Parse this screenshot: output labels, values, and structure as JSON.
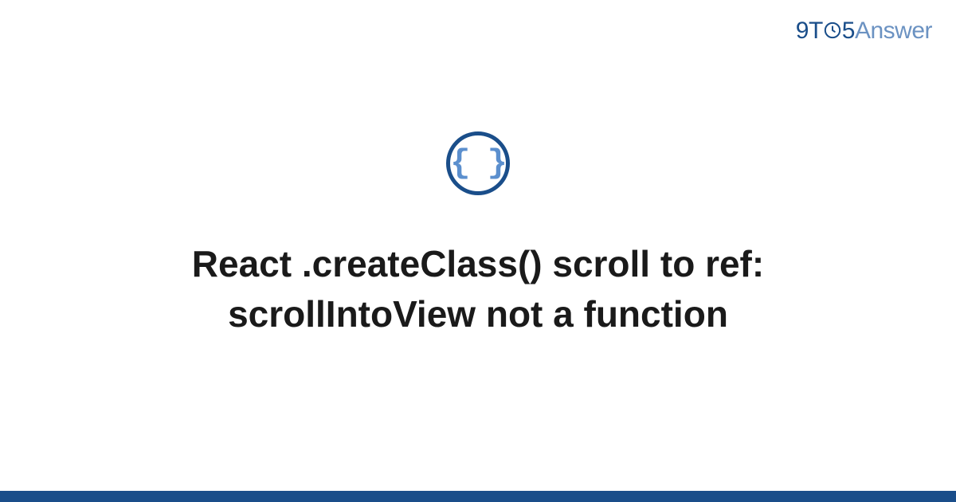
{
  "logo": {
    "nine": "9",
    "t": "T",
    "five": "5",
    "answer": "Answer"
  },
  "icon": {
    "braces": "{ }"
  },
  "title": "React .createClass() scroll to ref: scrollIntoView not a function"
}
